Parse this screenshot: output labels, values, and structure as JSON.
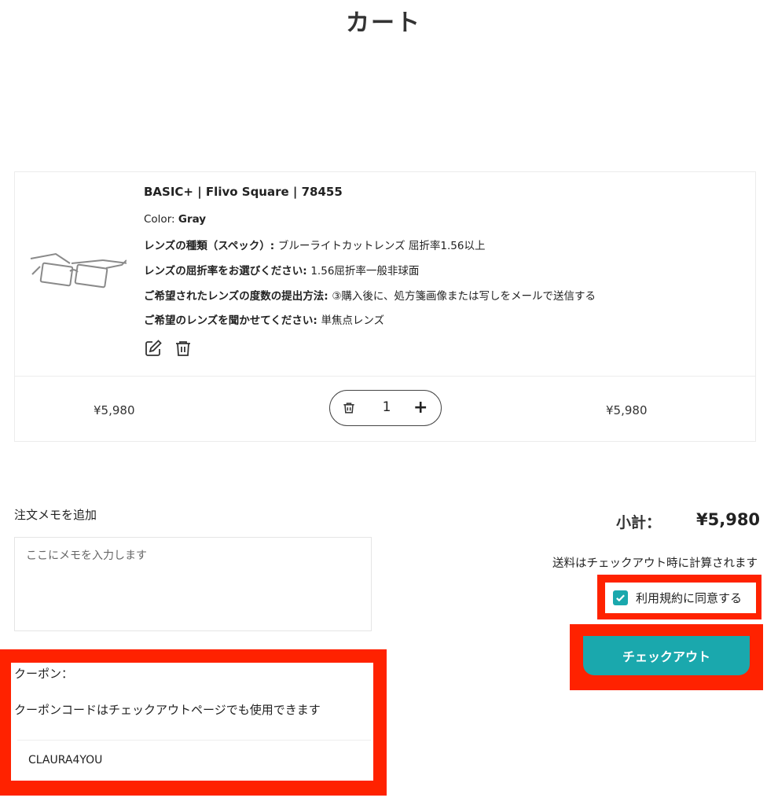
{
  "page": {
    "title": "カート"
  },
  "item": {
    "name": "BASIC+ | Flivo Square | 78455",
    "options": [
      {
        "label": "Color: ",
        "value": "Gray",
        "label_bold": false,
        "value_bold": true
      },
      {
        "label": "レンズの種類（スペック）: ",
        "value": "ブルーライトカットレンズ 屈折率1.56以上",
        "label_bold": true,
        "value_bold": false
      },
      {
        "label": "レンズの屈折率をお選びください: ",
        "value": "1.56屈折率一般非球面",
        "label_bold": true,
        "value_bold": false
      },
      {
        "label": "ご希望されたレンズの度数の提出方法: ",
        "value": "③購入後に、処方箋画像または写しをメールで送信する",
        "label_bold": true,
        "value_bold": false
      },
      {
        "label": "ご希望のレンズを聞かせてください: ",
        "value": "単焦点レンズ",
        "label_bold": true,
        "value_bold": false
      }
    ],
    "unit_price": "¥5,980",
    "quantity": "1",
    "line_total": "¥5,980",
    "icons": [
      "edit-icon",
      "trash-icon"
    ]
  },
  "memo": {
    "label": "注文メモを追加",
    "placeholder": "ここにメモを入力します"
  },
  "coupon": {
    "label": "クーポン：",
    "note": "クーポンコードはチェックアウトページでも使用できます",
    "value": "CLAURA4YOU"
  },
  "summary": {
    "subtotal_label": "小計：",
    "subtotal_value": "¥5,980",
    "shipping_note": "送料はチェックアウト時に計算されます",
    "terms_label": "利用規約に同意する",
    "terms_checked": true,
    "checkout_label": "チェックアウト"
  },
  "colors": {
    "accent": "#1aa8ad",
    "highlight": "#ff2200"
  }
}
